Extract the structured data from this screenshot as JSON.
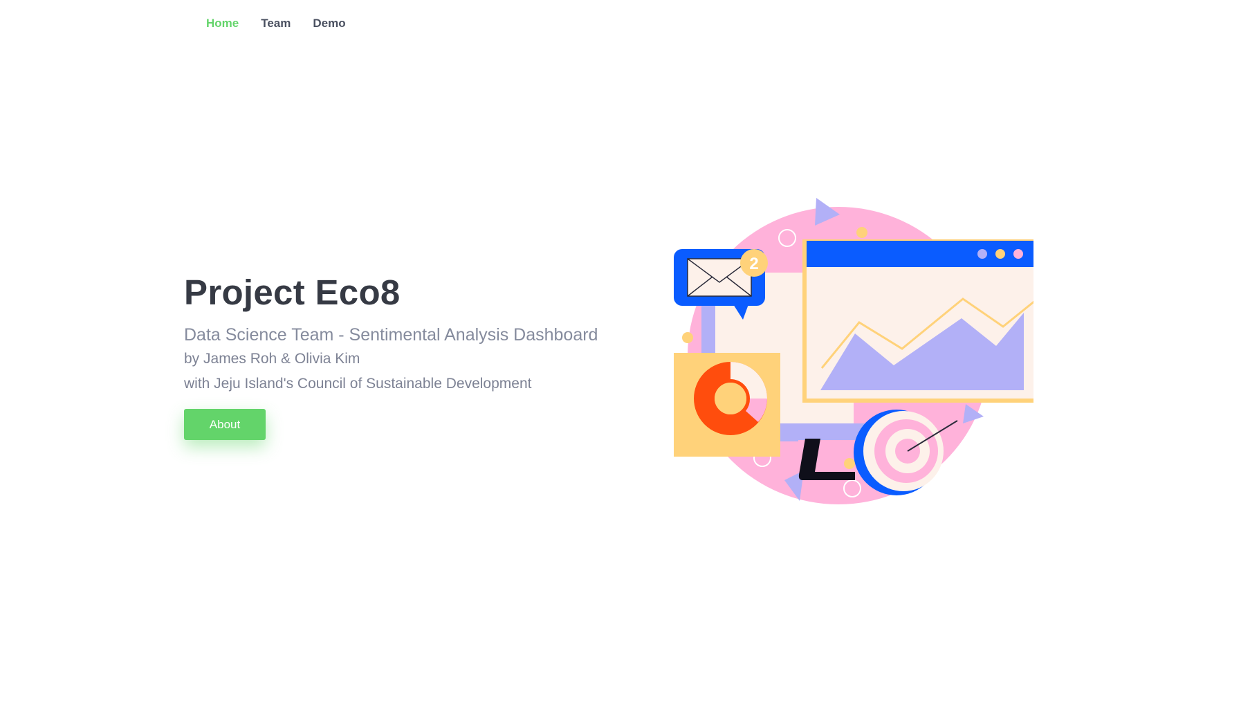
{
  "nav": {
    "items": [
      {
        "label": "Home",
        "active": true
      },
      {
        "label": "Team",
        "active": false
      },
      {
        "label": "Demo",
        "active": false
      }
    ]
  },
  "hero": {
    "title": "Project Eco8",
    "subtitle": "Data Science Team - Sentimental Analysis Dashboard",
    "authors": "by James Roh & Olivia Kim",
    "partner": "with Jeju Island's Council of Sustainable Development",
    "about_label": "About"
  },
  "illustration": {
    "notification_count": "2"
  },
  "colors": {
    "accent_green": "#63d46a",
    "title_dark": "#363a44",
    "muted_text": "#858b9d",
    "nav_text": "#4a5060",
    "illustration_blue": "#0a5cff",
    "illustration_pink": "#ffb2da",
    "illustration_lavender": "#b2b0f7",
    "illustration_yellow": "#ffd27a",
    "illustration_orange": "#ff4d0d"
  }
}
